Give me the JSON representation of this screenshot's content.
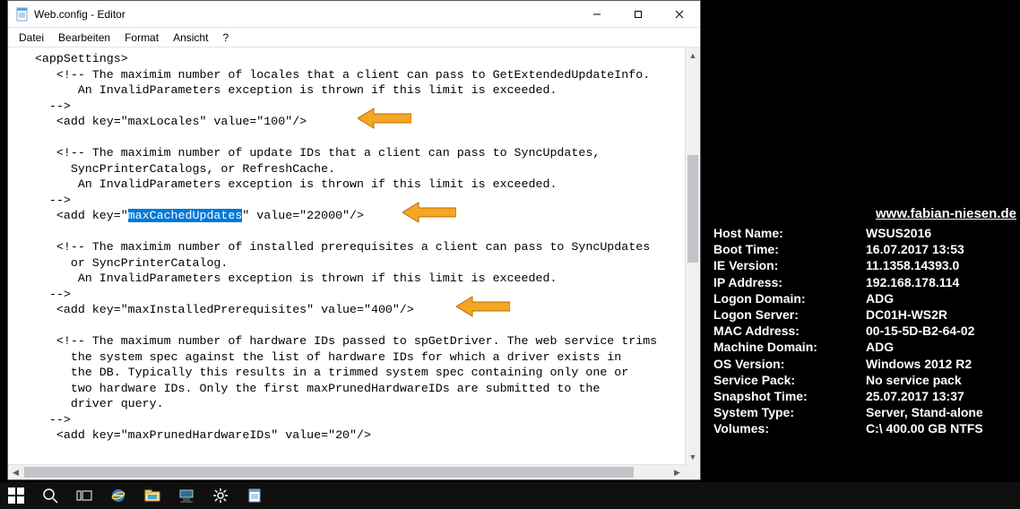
{
  "window": {
    "title": "Web.config - Editor",
    "menus": [
      "Datei",
      "Bearbeiten",
      "Format",
      "Ansicht",
      "?"
    ]
  },
  "editor": {
    "lines": [
      "   <appSettings>",
      "      <!-- The maximim number of locales that a client can pass to GetExtendedUpdateInfo.",
      "         An InvalidParameters exception is thrown if this limit is exceeded.",
      "     -->",
      "      <add key=\"maxLocales\" value=\"100\"/>",
      "",
      "      <!-- The maximim number of update IDs that a client can pass to SyncUpdates,",
      "        SyncPrinterCatalogs, or RefreshCache.",
      "         An InvalidParameters exception is thrown if this limit is exceeded.",
      "     -->",
      "      <add key=\"|HL|maxCachedUpdates|/HL|\" value=\"22000\"/>",
      "",
      "      <!-- The maximim number of installed prerequisites a client can pass to SyncUpdates",
      "        or SyncPrinterCatalog.",
      "         An InvalidParameters exception is thrown if this limit is exceeded.",
      "     -->",
      "      <add key=\"maxInstalledPrerequisites\" value=\"400\"/>",
      "",
      "      <!-- The maximum number of hardware IDs passed to spGetDriver. The web service trims",
      "        the system spec against the list of hardware IDs for which a driver exists in",
      "        the DB. Typically this results in a trimmed system spec containing only one or",
      "        two hardware IDs. Only the first maxPrunedHardwareIDs are submitted to the",
      "        driver query.",
      "     -->",
      "      <add key=\"maxPrunedHardwareIDs\" value=\"20\"/>"
    ],
    "selected_text": "maxCachedUpdates"
  },
  "arrows": [
    {
      "name": "arrow-max-locales"
    },
    {
      "name": "arrow-max-cached-updates"
    },
    {
      "name": "arrow-max-installed-prerequisites"
    }
  ],
  "info": {
    "url": "www.fabian-niesen.de",
    "rows": [
      {
        "label": "Host Name:",
        "value": "WSUS2016"
      },
      {
        "label": "Boot Time:",
        "value": "16.07.2017 13:53"
      },
      {
        "label": "IE Version:",
        "value": "11.1358.14393.0"
      },
      {
        "label": "IP Address:",
        "value": "192.168.178.114"
      },
      {
        "label": "Logon Domain:",
        "value": "ADG"
      },
      {
        "label": "Logon Server:",
        "value": "DC01H-WS2R"
      },
      {
        "label": "MAC Address:",
        "value": "00-15-5D-B2-64-02"
      },
      {
        "label": "Machine Domain:",
        "value": "ADG"
      },
      {
        "label": "OS Version:",
        "value": "Windows 2012 R2"
      },
      {
        "label": "Service Pack:",
        "value": "No service pack"
      },
      {
        "label": "Snapshot Time:",
        "value": "25.07.2017 13:37"
      },
      {
        "label": "System Type:",
        "value": "Server, Stand-alone"
      },
      {
        "label": "Volumes:",
        "value": "C:\\ 400.00 GB NTFS"
      }
    ]
  },
  "taskbar": {
    "items": [
      {
        "name": "start-icon"
      },
      {
        "name": "search-icon"
      },
      {
        "name": "taskview-icon"
      },
      {
        "name": "ie-icon"
      },
      {
        "name": "explorer-icon"
      },
      {
        "name": "server-manager-icon"
      },
      {
        "name": "settings-icon"
      },
      {
        "name": "notepad-icon"
      }
    ]
  }
}
